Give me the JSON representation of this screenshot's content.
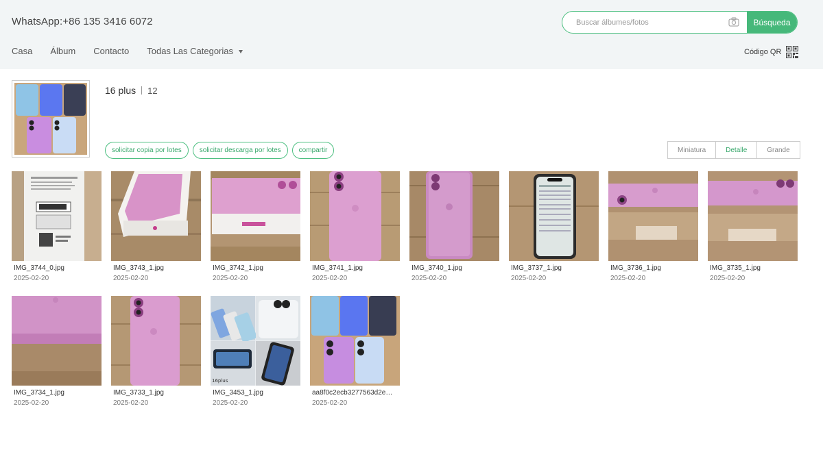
{
  "header": {
    "contact": "WhatsApp:+86 135 3416 6072",
    "search_placeholder": "Buscar álbumes/fotos",
    "search_button": "Búsqueda",
    "nav": [
      {
        "label": "Casa"
      },
      {
        "label": "Álbum"
      },
      {
        "label": "Contacto"
      },
      {
        "label": "Todas Las Categorias"
      }
    ],
    "qr_label": "Código QR"
  },
  "album": {
    "title": "16 plus",
    "count": "12",
    "actions": [
      "solicitar copia por lotes",
      "solicitar descarga por lotes",
      "compartir"
    ],
    "views": [
      "Miniatura",
      "Detalle",
      "Grande"
    ],
    "active_view": "Detalle"
  },
  "photos": [
    {
      "name": "IMG_3744_0.jpg",
      "date": "2025-02-20"
    },
    {
      "name": "IMG_3743_1.jpg",
      "date": "2025-02-20"
    },
    {
      "name": "IMG_3742_1.jpg",
      "date": "2025-02-20"
    },
    {
      "name": "IMG_3741_1.jpg",
      "date": "2025-02-20"
    },
    {
      "name": "IMG_3740_1.jpg",
      "date": "2025-02-20"
    },
    {
      "name": "IMG_3737_1.jpg",
      "date": "2025-02-20"
    },
    {
      "name": "IMG_3736_1.jpg",
      "date": "2025-02-20"
    },
    {
      "name": "IMG_3735_1.jpg",
      "date": "2025-02-20"
    },
    {
      "name": "IMG_3734_1.jpg",
      "date": "2025-02-20"
    },
    {
      "name": "IMG_3733_1.jpg",
      "date": "2025-02-20"
    },
    {
      "name": "IMG_3453_1.jpg",
      "date": "2025-02-20"
    },
    {
      "name": "aa8f0c2ecb3277563d2e…",
      "date": "2025-02-20"
    }
  ],
  "colors": {
    "accent": "#46b87a",
    "header_bg": "#f2f5f6",
    "phone_pink": "#d58fc9",
    "wood": "#b89a72"
  },
  "icons": [
    "camera-icon",
    "caret-down-icon",
    "qr-code-icon"
  ]
}
